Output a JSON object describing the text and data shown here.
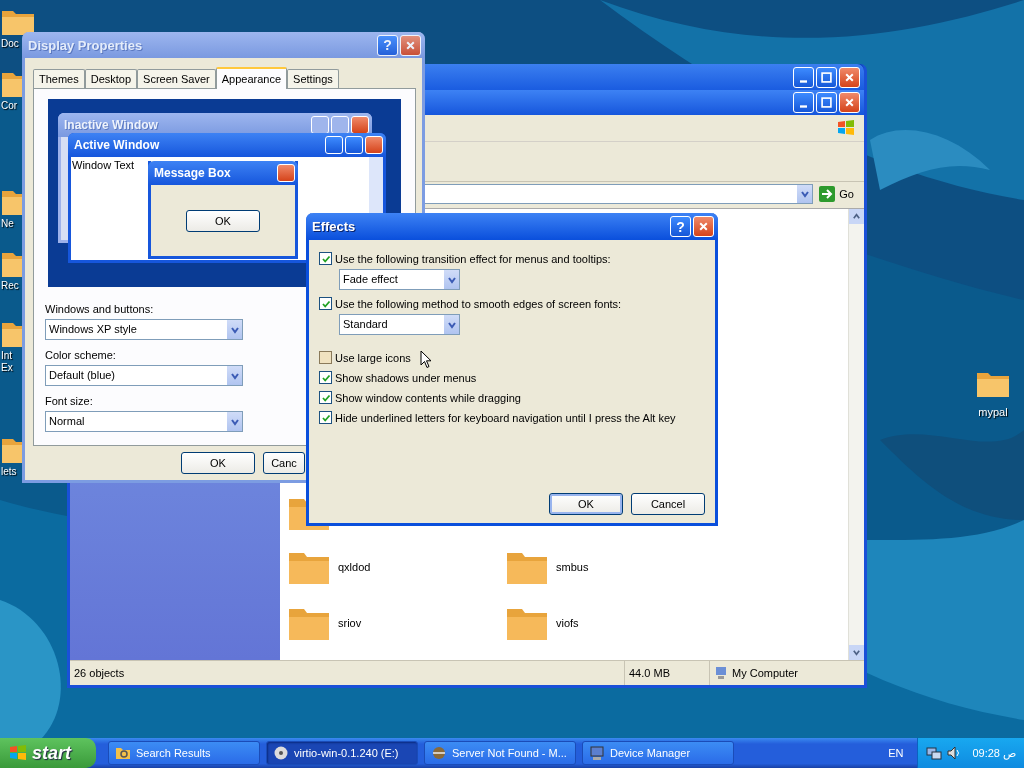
{
  "desktop_icons": [
    {
      "label": "Doc"
    },
    {
      "label": "Cor"
    },
    {
      "label": "Ne"
    },
    {
      "label": "Rec"
    },
    {
      "label": "Int Ex"
    },
    {
      "label": "lets"
    },
    {
      "label": "mypal"
    }
  ],
  "explorer": {
    "go": "Go",
    "folders": [
      {
        "name": "qxldod"
      },
      {
        "name": "smbus"
      },
      {
        "name": "sriov"
      },
      {
        "name": "viofs"
      }
    ],
    "status_bar": [
      "26 objects",
      "44.0 MB",
      "My Computer"
    ]
  },
  "display_properties": {
    "title": "Display Properties",
    "help": "?",
    "tabs": [
      {
        "label": "Themes",
        "selected": false
      },
      {
        "label": "Desktop",
        "selected": false
      },
      {
        "label": "Screen Saver",
        "selected": false
      },
      {
        "label": "Appearance",
        "selected": true
      },
      {
        "label": "Settings",
        "selected": false
      }
    ],
    "preview": {
      "inactive_title": "Inactive Window",
      "active_title": "Active Window",
      "window_text": "Window Text",
      "message_title": "Message Box",
      "message_button": "OK"
    },
    "fields": [
      {
        "label": "Windows and buttons:",
        "value": "Windows XP style"
      },
      {
        "label": "Color scheme:",
        "value": "Default (blue)"
      },
      {
        "label": "Font size:",
        "value": "Normal"
      }
    ],
    "buttons": [
      "OK",
      "Canc"
    ]
  },
  "effects": {
    "title": "Effects",
    "help": "?",
    "options": [
      {
        "label": "Use the following transition effect for menus and tooltips:",
        "checked": true,
        "dropdown": "Fade effect"
      },
      {
        "label": "Use the following method to smooth edges of screen fonts:",
        "checked": true,
        "dropdown": "Standard"
      },
      {
        "label": "Use large icons",
        "checked": false
      },
      {
        "label": "Show shadows under menus",
        "checked": true
      },
      {
        "label": "Show window contents while dragging",
        "checked": true
      },
      {
        "label": "Hide underlined letters for keyboard navigation until I press the Alt key",
        "checked": true
      }
    ],
    "buttons": [
      "OK",
      "Cancel"
    ]
  },
  "taskbar": {
    "start": "start",
    "tasks": [
      {
        "label": "Search Results",
        "selected": false
      },
      {
        "label": "virtio-win-0.1.240 (E:)",
        "selected": true
      },
      {
        "label": "Server Not Found - M...",
        "selected": false
      },
      {
        "label": "Device Manager",
        "selected": false
      }
    ],
    "language": "EN",
    "clock": "09:28 ص"
  }
}
